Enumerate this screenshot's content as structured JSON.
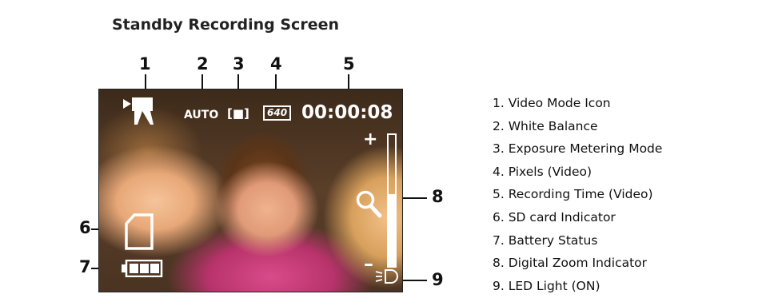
{
  "title": "Standby Recording Screen",
  "callouts": {
    "n1": "1",
    "n2": "2",
    "n3": "3",
    "n4": "4",
    "n5": "5",
    "n6": "6",
    "n7": "7",
    "n8": "8",
    "n9": "9"
  },
  "screen": {
    "mode_icon": "video-camera-icon",
    "white_balance": "AUTO",
    "metering": "[■]",
    "pixels": "640",
    "recording_time": "00:00:08",
    "zoom_plus": "+",
    "zoom_minus": "–",
    "zoom_level_fraction": 0.55,
    "sd_icon": "sd-card-icon",
    "battery_icon": "battery-full-icon",
    "battery_bars": 3,
    "led_icon": "led-light-icon",
    "osd_color": "#ffffff"
  },
  "legend": [
    "1. Video Mode Icon",
    "2. White Balance",
    "3. Exposure Metering Mode",
    "4. Pixels (Video)",
    "5. Recording Time (Video)",
    "6. SD card Indicator",
    "7. Battery Status",
    "8. Digital Zoom Indicator",
    "9. LED Light (ON)"
  ]
}
